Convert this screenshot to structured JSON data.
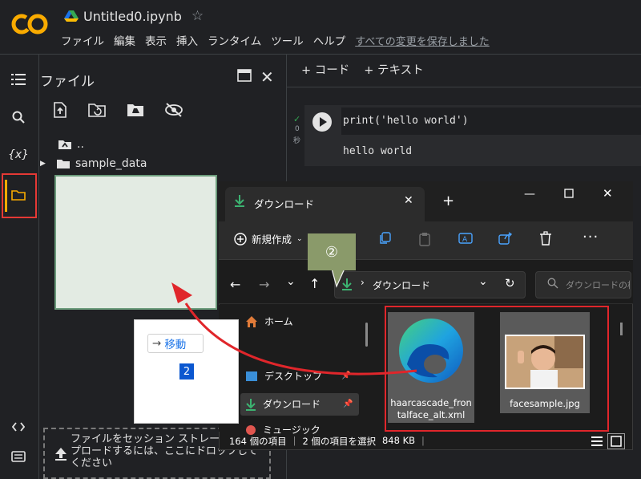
{
  "app": {
    "logo": "CO",
    "notebook_title": "Untitled0.ipynb",
    "menu": [
      "ファイル",
      "編集",
      "表示",
      "挿入",
      "ランタイム",
      "ツール",
      "ヘルプ"
    ],
    "save_status": "すべての変更を保存しました"
  },
  "sidebar": {
    "rail_icons": [
      "menu-icon",
      "search-icon",
      "variables-icon",
      "folder-icon"
    ],
    "variables_glyph": "{x}",
    "bottom_icons": [
      "code-icon",
      "terminal-icon"
    ]
  },
  "files_panel": {
    "title": "ファイル",
    "toolbar_icons": [
      "upload-file-icon",
      "refresh-icon",
      "drive-icon",
      "hide-icon"
    ],
    "tree": [
      {
        "label": ".."
      },
      {
        "label": "sample_data"
      }
    ],
    "drop_text": "ファイルをセッション ストレージにアップロードするには、ここにドロップしてください"
  },
  "notebook": {
    "add_code": "+ コード",
    "add_text": "+ テキスト",
    "code": "print('hello world')",
    "output": "hello world",
    "exec_count": "0",
    "exec_time": "秒"
  },
  "drag_tooltip": {
    "action": "移動",
    "count": "2"
  },
  "callout": {
    "label": "②"
  },
  "explorer": {
    "tab_label": "ダウンロード",
    "new_button": "新規作成",
    "address": "ダウンロード",
    "search_placeholder": "ダウンロードの検索",
    "sidebar": [
      {
        "label": "ホーム",
        "icon": "home-icon"
      },
      {
        "label": "デスクトップ",
        "icon": "desktop-icon"
      },
      {
        "label": "ダウンロード",
        "icon": "download-icon"
      },
      {
        "label": "ミュージック",
        "icon": "music-icon"
      }
    ],
    "files": [
      {
        "line1": "haarcascade_fron",
        "line2": "talface_alt.xml",
        "icon": "edge-icon"
      },
      {
        "line1": "facesample.jpg",
        "line2": "",
        "icon": "photo-thumbnail"
      }
    ],
    "status": {
      "items": "164 個の項目",
      "selected": "2 個の項目を選択",
      "size": "848 KB"
    }
  },
  "colors": {
    "logo_orange": "#f9ab00",
    "highlight_red": "#e53935",
    "drag_arrow": "#e0262b",
    "callout_green": "#8a9a6a"
  }
}
